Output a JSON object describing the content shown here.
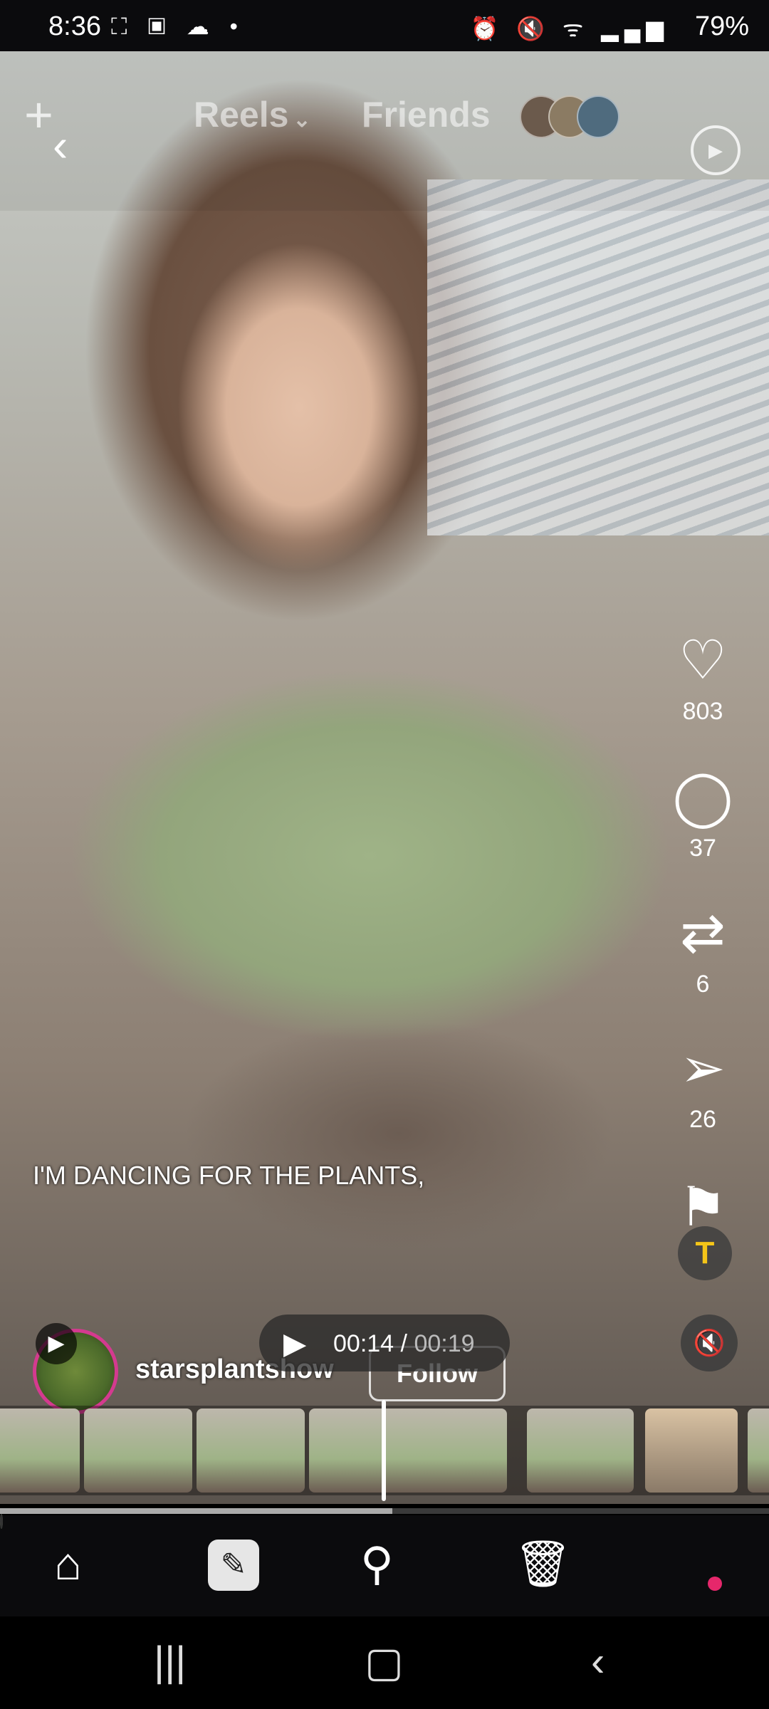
{
  "status_bar": {
    "time": "8:36",
    "left_icons": "⛶ ▣ ☁ •",
    "right_icons": "⏰ 🔇 ᯤ ▂▄▆",
    "battery": "79%"
  },
  "top": {
    "tab_reels": "Reels",
    "tab_friends": "Friends"
  },
  "actions": {
    "like_count": "803",
    "comment_count": "37",
    "repost_count": "6",
    "share_count": "26"
  },
  "caption": "I'M DANCING FOR THE PLANTS,",
  "author": {
    "username": "starsplantshow",
    "follow_label": "Follow"
  },
  "player": {
    "current_time": "00:14",
    "duration": "00:19",
    "progress": 0.51
  },
  "icons": {
    "plus": "plus-icon",
    "back": "chevron-left-icon",
    "refresh": "refresh-icon",
    "like": "heart-icon",
    "comment": "comment-icon",
    "repost": "repost-icon",
    "share": "send-icon",
    "save": "bookmark-icon",
    "text": "text-icon",
    "mute": "mute-icon"
  },
  "colors": {
    "accent_yellow": "#f5c518",
    "story_ring": "#d43a8f",
    "notification_dot": "#e6276b"
  }
}
